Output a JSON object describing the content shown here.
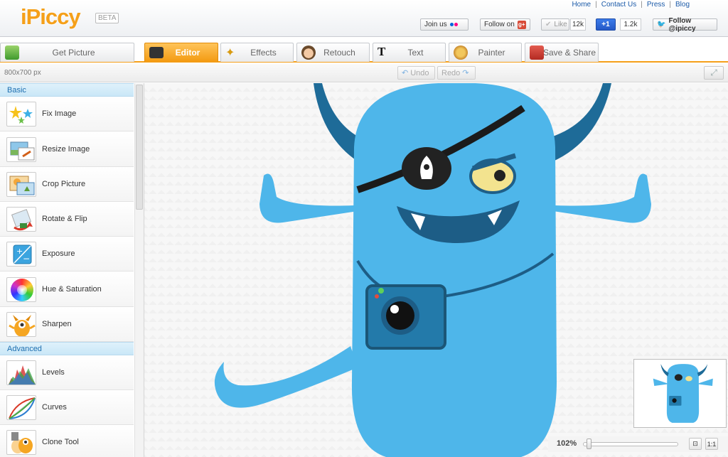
{
  "app": {
    "logo": "iPiccy",
    "beta": "BETA"
  },
  "toplinks": [
    "Home",
    "Contact Us",
    "Press",
    "Blog"
  ],
  "social": {
    "join_us": "Join us",
    "follow_on": "Follow on",
    "like": "Like",
    "like_count": "12k",
    "plusone": "+1",
    "plusone_count": "1.2k",
    "follow_twitter": "Follow @ipiccy"
  },
  "tabs": [
    {
      "label": "Get Picture",
      "icon": "save-download-icon"
    },
    {
      "label": "Editor",
      "icon": "camera-icon",
      "active": true
    },
    {
      "label": "Effects",
      "icon": "magic-wand-icon"
    },
    {
      "label": "Retouch",
      "icon": "face-icon"
    },
    {
      "label": "Text",
      "icon": "text-t-icon"
    },
    {
      "label": "Painter",
      "icon": "palette-icon"
    },
    {
      "label": "Save & Share",
      "icon": "floppy-disk-icon"
    }
  ],
  "toolbar": {
    "dimensions": "800x700 px",
    "undo": "Undo",
    "redo": "Redo"
  },
  "sidebar": {
    "basic_label": "Basic",
    "advanced_label": "Advanced",
    "basic_tools": [
      {
        "label": "Fix Image",
        "icon": "stars-icon"
      },
      {
        "label": "Resize Image",
        "icon": "resize-icon"
      },
      {
        "label": "Crop Picture",
        "icon": "crop-icon"
      },
      {
        "label": "Rotate & Flip",
        "icon": "rotate-icon"
      },
      {
        "label": "Exposure",
        "icon": "exposure-icon"
      },
      {
        "label": "Hue & Saturation",
        "icon": "color-wheel-icon"
      },
      {
        "label": "Sharpen",
        "icon": "monster-icon"
      }
    ],
    "advanced_tools": [
      {
        "label": "Levels",
        "icon": "histogram-icon"
      },
      {
        "label": "Curves",
        "icon": "curves-icon"
      },
      {
        "label": "Clone Tool",
        "icon": "clone-stamp-icon"
      }
    ]
  },
  "zoom": {
    "value": "102%",
    "fit": "⊡",
    "actual": "1:1",
    "level_fraction": 0.04
  },
  "colors": {
    "accent": "#f5a01a",
    "monster": "#4eb6ea",
    "section": "#1e6fb0"
  }
}
